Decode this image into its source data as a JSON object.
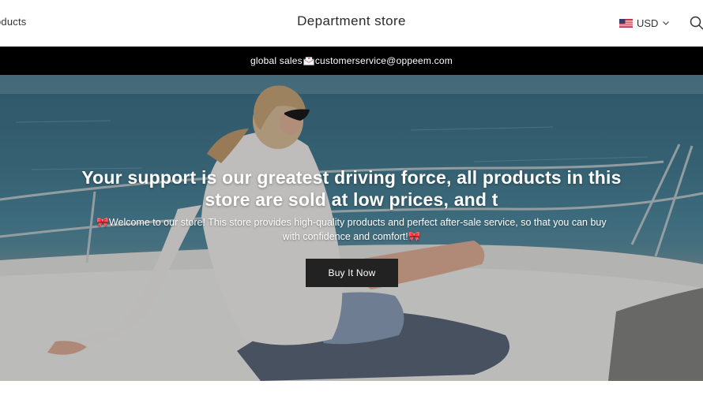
{
  "header": {
    "nav_products": "oducts",
    "store_title": "Department store",
    "currency": {
      "label": "USD",
      "flag_icon": "us-flag-icon"
    },
    "search_icon": "search-icon"
  },
  "announcement": {
    "text_before": "global sales",
    "icon": "mail-icon",
    "email": "customerservice@oppeem.com"
  },
  "hero": {
    "heading": "Your support is our greatest driving force, all products in this store are sold at low prices, and t",
    "subtext_icon": "🎀",
    "subtext": "Welcome to our store! This store provides high-quality products and perfect after-sale service, so that you can buy with confidence and comfort!",
    "button_label": "Buy It Now"
  },
  "colors": {
    "announcement_bg": "#000000",
    "button_bg": "#222222",
    "text_white": "#ffffff"
  }
}
